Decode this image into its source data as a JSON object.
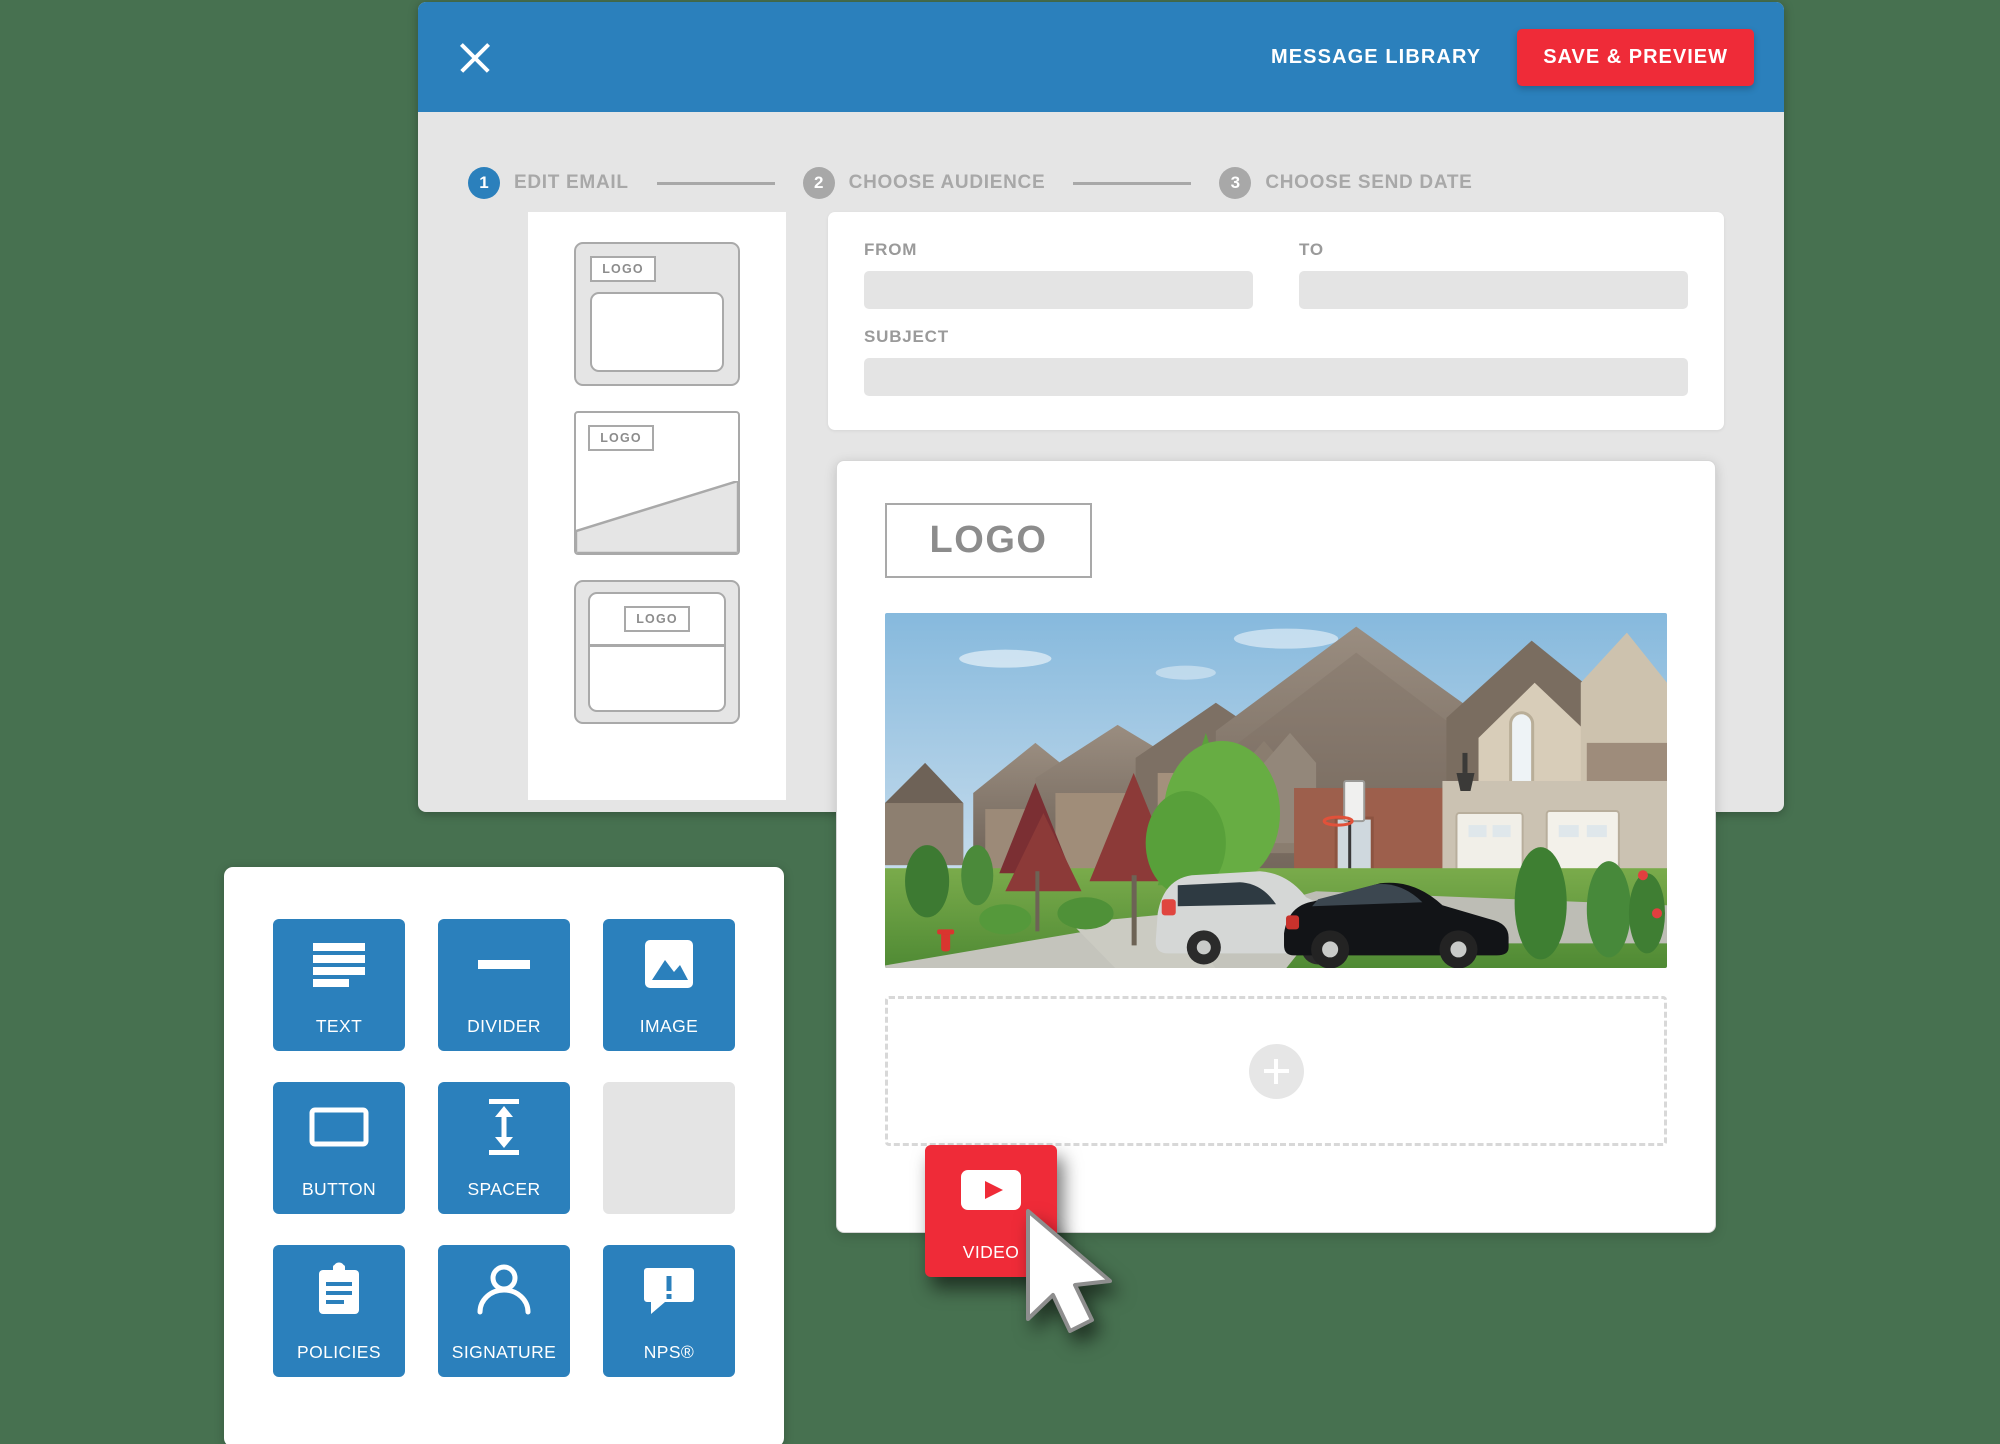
{
  "background_color": "#477150",
  "colors": {
    "primary_blue": "#2b80bc",
    "accent_red": "#ef2b38",
    "panel_gray": "#e5e5e5",
    "muted_gray": "#a8a8a8"
  },
  "builder": {
    "header": {
      "close_icon": "close-icon",
      "message_library_label": "MESSAGE LIBRARY",
      "save_preview_label": "SAVE & PREVIEW"
    },
    "stepper": {
      "steps": [
        {
          "number": "1",
          "label": "EDIT EMAIL",
          "active": true
        },
        {
          "number": "2",
          "label": "CHOOSE AUDIENCE",
          "active": false
        },
        {
          "number": "3",
          "label": "CHOOSE SEND DATE",
          "active": false
        }
      ]
    },
    "templates": [
      {
        "logo_label": "LOGO",
        "style": "boxed"
      },
      {
        "logo_label": "LOGO",
        "style": "diagonal"
      },
      {
        "logo_label": "LOGO",
        "style": "split"
      }
    ],
    "meta_form": {
      "from": {
        "label": "FROM",
        "value": "",
        "placeholder": ""
      },
      "to": {
        "label": "TO",
        "value": "",
        "placeholder": ""
      },
      "subject": {
        "label": "SUBJECT",
        "value": "",
        "placeholder": ""
      }
    },
    "preview": {
      "logo_label": "LOGO",
      "photo_alt": "suburban-houses-with-parked-cars",
      "dropzone": {
        "add_icon": "plus-icon"
      }
    }
  },
  "palette": {
    "tiles": [
      {
        "label": "TEXT",
        "icon": "text-lines-icon",
        "enabled": true
      },
      {
        "label": "DIVIDER",
        "icon": "divider-icon",
        "enabled": true
      },
      {
        "label": "IMAGE",
        "icon": "image-icon",
        "enabled": true
      },
      {
        "label": "BUTTON",
        "icon": "button-icon",
        "enabled": true
      },
      {
        "label": "SPACER",
        "icon": "spacer-icon",
        "enabled": true
      },
      {
        "label": "",
        "icon": "",
        "enabled": false
      },
      {
        "label": "POLICIES",
        "icon": "clipboard-icon",
        "enabled": true
      },
      {
        "label": "SIGNATURE",
        "icon": "person-icon",
        "enabled": true
      },
      {
        "label": "NPS®",
        "icon": "speech-bubble-icon",
        "enabled": true
      }
    ]
  },
  "drag": {
    "ghost_label": "VIDEO",
    "ghost_icon": "play-button-icon",
    "ghost_color": "#ef2b38",
    "cursor_icon": "mouse-pointer-icon"
  }
}
